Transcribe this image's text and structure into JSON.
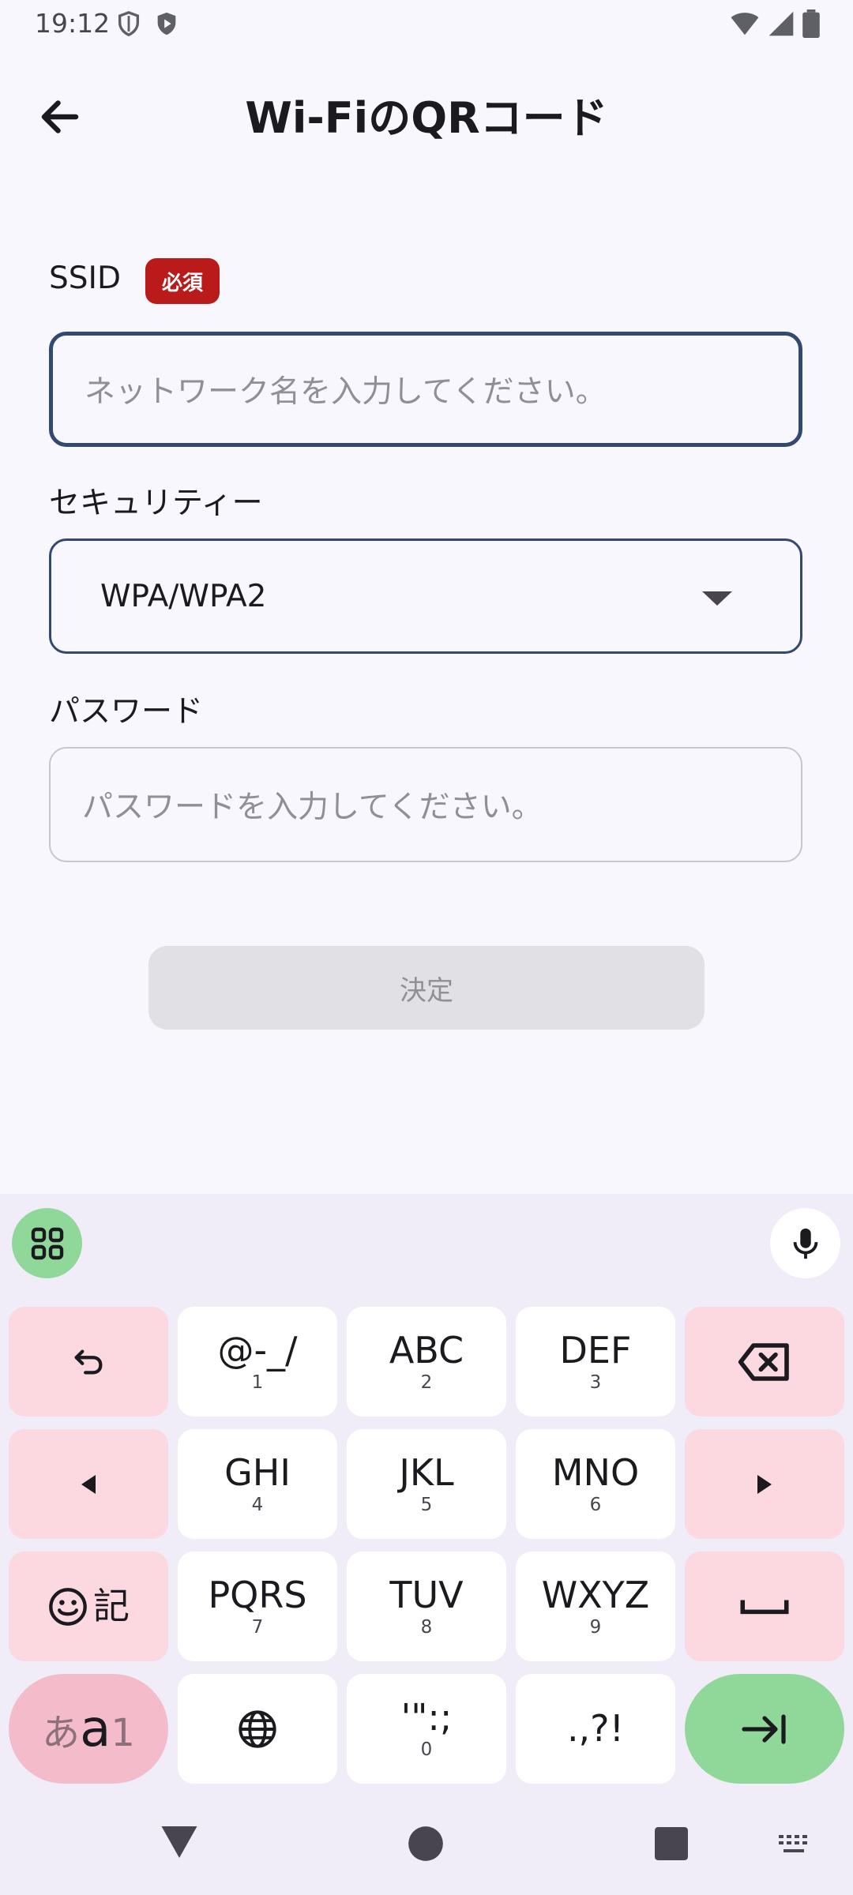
{
  "status_bar": {
    "time": "19:12",
    "left_icons": [
      "shield-outline-icon",
      "shield-play-icon"
    ],
    "right_icons": [
      "wifi-icon",
      "signal-icon",
      "battery-icon"
    ]
  },
  "header": {
    "back_icon": "arrow-back-icon",
    "title": "Wi-FiのQRコード"
  },
  "form": {
    "ssid": {
      "label": "SSID",
      "required_badge": "必須",
      "value": "",
      "placeholder": "ネットワーク名を入力してください。"
    },
    "security": {
      "label": "セキュリティー",
      "selected": "WPA/WPA2"
    },
    "password": {
      "label": "パスワード",
      "value": "",
      "placeholder": "パスワードを入力してください。"
    },
    "confirm_label": "決定"
  },
  "keyboard": {
    "colors": {
      "function_key": "#fcd9e1",
      "letter_key": "#ffffff",
      "accent_green": "#90d79a"
    },
    "rows": [
      [
        {
          "name": "undo-key",
          "icon": "undo-icon"
        },
        {
          "name": "key-1",
          "main": "@-_/",
          "sub": "1"
        },
        {
          "name": "key-2",
          "main": "ABC",
          "sub": "2"
        },
        {
          "name": "key-3",
          "main": "DEF",
          "sub": "3"
        },
        {
          "name": "backspace-key",
          "icon": "backspace-icon"
        }
      ],
      [
        {
          "name": "cursor-left-key",
          "icon": "triangle-left-icon"
        },
        {
          "name": "key-4",
          "main": "GHI",
          "sub": "4"
        },
        {
          "name": "key-5",
          "main": "JKL",
          "sub": "5"
        },
        {
          "name": "key-6",
          "main": "MNO",
          "sub": "6"
        },
        {
          "name": "cursor-right-key",
          "icon": "triangle-right-icon"
        }
      ],
      [
        {
          "name": "emoji-symbol-key",
          "icon": "emoji-icon",
          "main": "記"
        },
        {
          "name": "key-7",
          "main": "PQRS",
          "sub": "7"
        },
        {
          "name": "key-8",
          "main": "TUV",
          "sub": "8"
        },
        {
          "name": "key-9",
          "main": "WXYZ",
          "sub": "9"
        },
        {
          "name": "space-key",
          "icon": "space-icon"
        }
      ],
      [
        {
          "name": "input-mode-key",
          "main_small": "あ",
          "main_big": "a",
          "main_tail": "1"
        },
        {
          "name": "globe-key",
          "icon": "globe-icon"
        },
        {
          "name": "key-0",
          "main": "'\":;",
          "sub": "0"
        },
        {
          "name": "punctuation-key",
          "main": ".,?!"
        },
        {
          "name": "tab-key",
          "icon": "tab-arrow-icon"
        }
      ]
    ]
  },
  "nav_bar": {
    "icons": [
      "back-triangle-icon",
      "home-circle-icon",
      "recents-square-icon",
      "keyboard-switch-icon"
    ]
  }
}
